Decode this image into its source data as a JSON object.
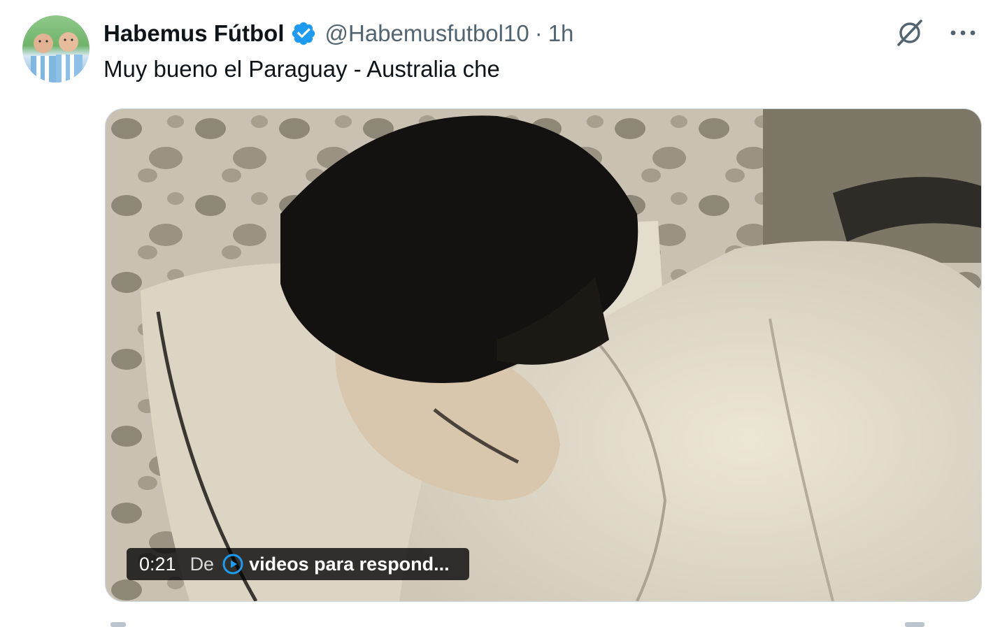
{
  "tweet": {
    "display_name": "Habemus Fútbol",
    "handle": "@Habemusfutbol10",
    "separator": "·",
    "time": "1h",
    "text": "Muy bueno el Paraguay - Australia che",
    "icons": {
      "verified": "verified-badge-icon",
      "grok": "grok-icon",
      "more": "more-options-icon"
    }
  },
  "video": {
    "duration": "0:21",
    "from_label": "De",
    "source_name": "videos para respond...",
    "source_icon": "play-circle-icon"
  },
  "colors": {
    "verified": "#1d9bf0",
    "secondary_text": "#536471",
    "primary_text": "#0f1419"
  }
}
